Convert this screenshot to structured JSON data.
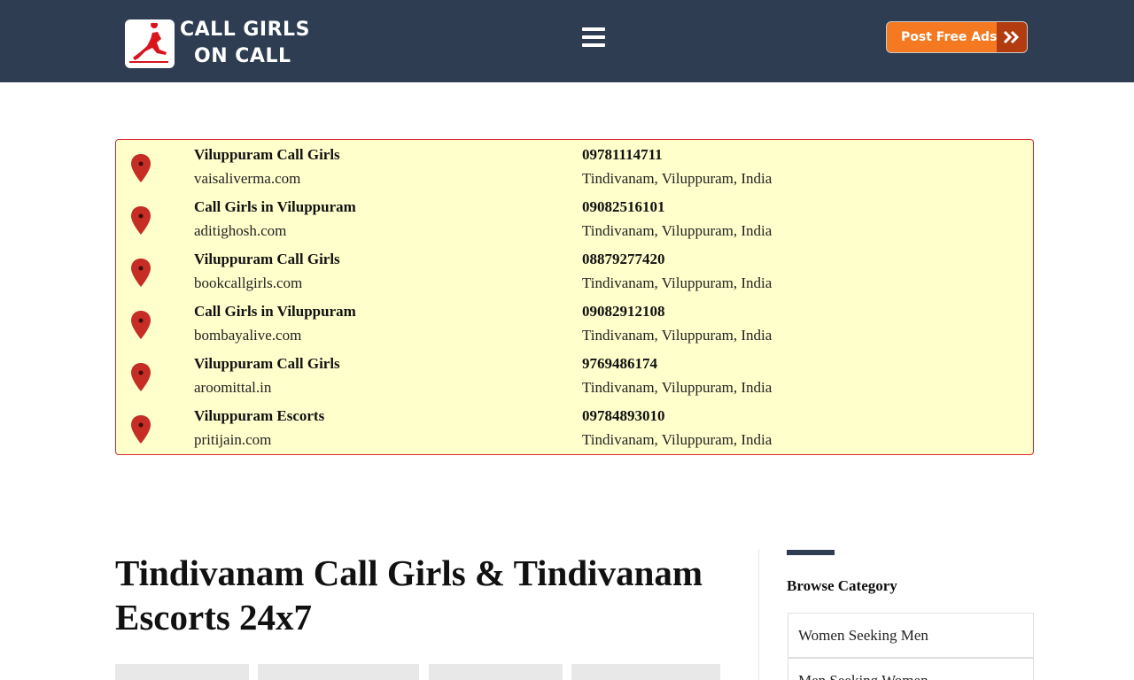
{
  "header": {
    "logo_line1": "CALL GIRLS",
    "logo_line2": "ON CALL",
    "menu_icon": "hamburger-icon",
    "post_button_label": "Post Free Ads",
    "post_button_icon": "double-chevron-right-icon",
    "bg_color": "#2e3d52",
    "accent_color": "#f47920"
  },
  "listings": [
    {
      "title": "Viluppuram Call Girls",
      "site": "vaisaliverma.com",
      "phone": "09781114711",
      "location": "Tindivanam, Viluppuram, India"
    },
    {
      "title": "Call Girls in Viluppuram",
      "site": "aditighosh.com",
      "phone": "09082516101",
      "location": "Tindivanam, Viluppuram, India"
    },
    {
      "title": "Viluppuram Call Girls",
      "site": "bookcallgirls.com",
      "phone": "08879277420",
      "location": "Tindivanam, Viluppuram, India"
    },
    {
      "title": "Call Girls in Viluppuram",
      "site": "bombayalive.com",
      "phone": "09082912108",
      "location": "Tindivanam, Viluppuram, India"
    },
    {
      "title": "Viluppuram Call Girls",
      "site": "aroomittal.in",
      "phone": "9769486174",
      "location": "Tindivanam, Viluppuram, India"
    },
    {
      "title": "Viluppuram Escorts",
      "site": "pritijain.com",
      "phone": "09784893010",
      "location": "Tindivanam, Viluppuram, India"
    }
  ],
  "main": {
    "title": "Tindivanam Call Girls & Tindivanam Escorts 24x7"
  },
  "sidebar": {
    "title": "Browse Category",
    "categories": [
      "Women Seeking Men",
      "Men Seeking Women"
    ]
  }
}
